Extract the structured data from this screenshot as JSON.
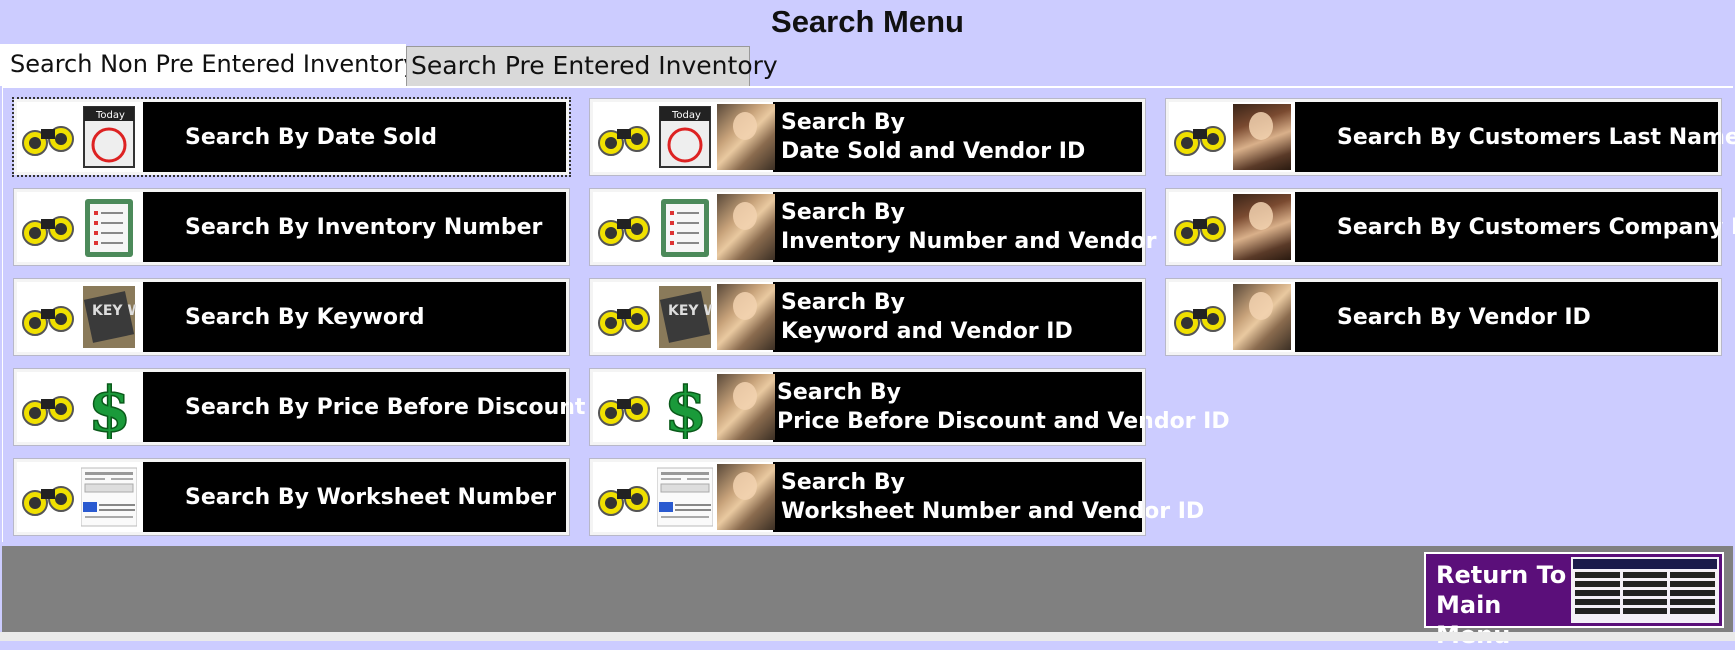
{
  "title": "Search Menu",
  "tabs": [
    {
      "label": "Search Non Pre Entered Inventory",
      "active": true
    },
    {
      "label": "Search Pre Entered Inventory",
      "active": false
    }
  ],
  "buttons": {
    "col1": [
      {
        "line1": "Search By Date Sold"
      },
      {
        "line1": "Search By Inventory Number"
      },
      {
        "line1": "Search By Keyword"
      },
      {
        "line1": "Search By Price Before Discount"
      },
      {
        "line1": "Search By Worksheet Number"
      }
    ],
    "col2": [
      {
        "line1": "Search By",
        "line2": "Date Sold and Vendor ID"
      },
      {
        "line1": "Search By",
        "line2": "Inventory Number and Vendor ID"
      },
      {
        "line1": "Search By",
        "line2": "Keyword and Vendor ID"
      },
      {
        "line1": "Search By",
        "line2": "Price Before Discount and Vendor ID"
      },
      {
        "line1": "Search By",
        "line2": "Worksheet Number and Vendor ID"
      }
    ],
    "col3": [
      {
        "line1": "Search By Customers Last Name"
      },
      {
        "line1": "Search By Customers Company Name"
      },
      {
        "line1": "Search By Vendor ID"
      }
    ]
  },
  "icons": {
    "binoculars": "binoculars-icon",
    "calendar": "today-calendar-icon",
    "clipboard": "clipboard-checklist-icon",
    "keyword": "keyword-cube-icon",
    "dollar": "dollar-sign-icon",
    "worksheet": "worksheet-thumbnail-icon",
    "vendor": "vendor-photo-icon",
    "customer": "customer-photo-icon"
  },
  "calendar_text": "Today",
  "keyword_text": "KEY Words",
  "dollar_text": "$",
  "return_button": {
    "line1": "Return To",
    "line2": "Main Menu"
  },
  "colors": {
    "background": "#ccccff",
    "button": "#000000",
    "return": "#5b0f7a",
    "bottom_bar": "#808080"
  }
}
